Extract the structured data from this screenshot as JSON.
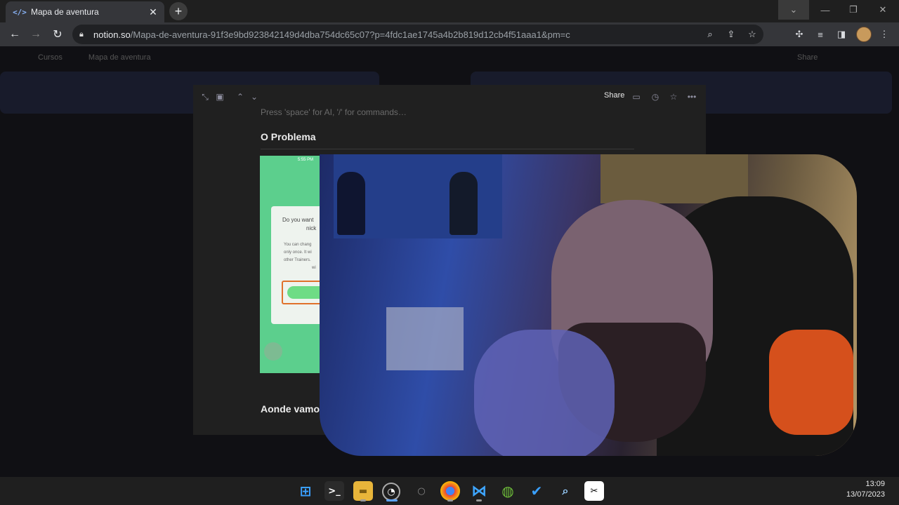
{
  "browser": {
    "tab_title": "Mapa de aventura",
    "tab_favicon": "code-brackets-icon",
    "url_domain": "notion.so",
    "url_path": "/Mapa-de-aventura-91f3e9bd923842149d4dba754dc65c07?p=4fdc1ae1745a4b2b819d12cb4f51aaa1&pm=c"
  },
  "page_bg": {
    "breadcrumb_1": "Cursos",
    "breadcrumb_2": "Mapa de aventura",
    "share": "Share"
  },
  "modal": {
    "share_label": "Share",
    "placeholder": "Press 'space' for AI, '/' for commands…",
    "heading_1": "O Problema",
    "heading_2": "Aonde vamo",
    "phone": {
      "time": "5:55 PM",
      "question_1": "Do you want",
      "question_2": "nick",
      "sub_1": "You can chang",
      "sub_2": "only once. It wi",
      "sub_3": "other Trainers.",
      "sub_4": "wi"
    }
  },
  "taskbar": {
    "time": "13:09",
    "date": "13/07/2023"
  },
  "colors": {
    "accent": "#8ab4f8",
    "phone_green": "#5ccf8d",
    "highlight_orange": "#e0712b",
    "chair_red": "#d5501c"
  }
}
